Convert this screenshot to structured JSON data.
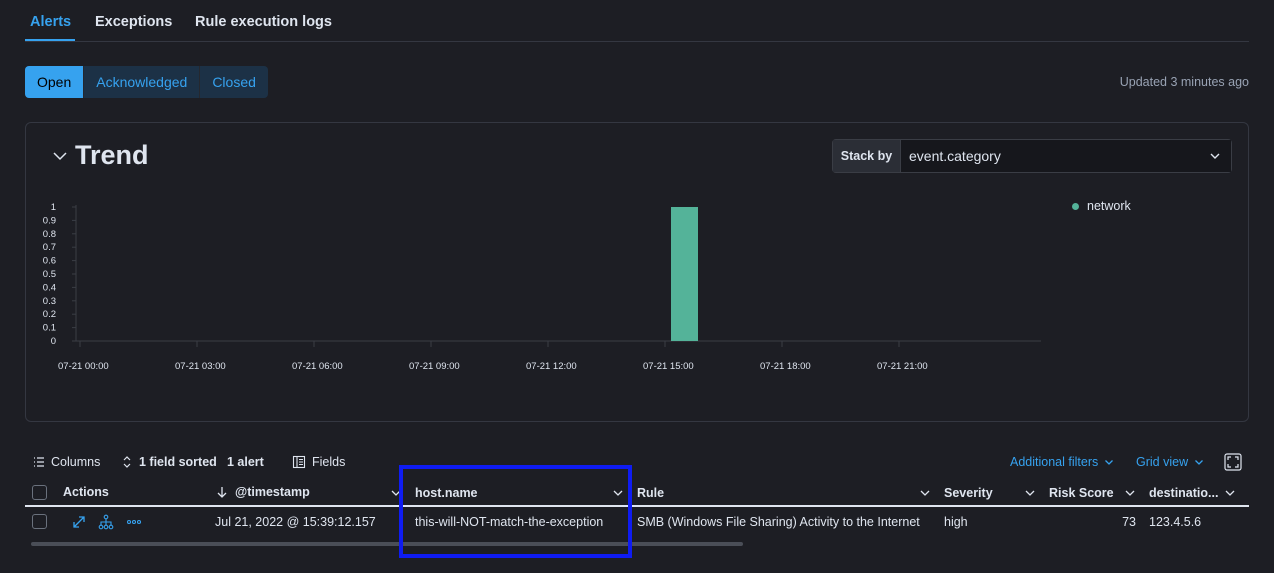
{
  "tabs": [
    {
      "label": "Alerts",
      "active": true
    },
    {
      "label": "Exceptions",
      "active": false
    },
    {
      "label": "Rule execution logs",
      "active": false
    }
  ],
  "status_filter": {
    "options": [
      "Open",
      "Acknowledged",
      "Closed"
    ],
    "selected": "Open"
  },
  "updated_text": "Updated 3 minutes ago",
  "trend": {
    "title": "Trend",
    "stack_by_label": "Stack by",
    "stack_by_value": "event.category"
  },
  "chart_data": {
    "type": "bar",
    "title": "",
    "xlabel": "",
    "ylabel": "",
    "x_ticks": [
      "07-21 00:00",
      "07-21 03:00",
      "07-21 06:00",
      "07-21 09:00",
      "07-21 12:00",
      "07-21 15:00",
      "07-21 18:00",
      "07-21 21:00"
    ],
    "y_ticks": [
      "0",
      "0.1",
      "0.2",
      "0.3",
      "0.4",
      "0.5",
      "0.6",
      "0.7",
      "0.8",
      "0.9",
      "1"
    ],
    "ylim": [
      0,
      1
    ],
    "series": [
      {
        "name": "network",
        "color": "#54b399",
        "points": [
          {
            "x": "07-21 15:30",
            "y": 1
          }
        ]
      }
    ],
    "legend_position": "right",
    "grid": false
  },
  "table": {
    "toolbar": {
      "columns_label": "Columns",
      "sorted_label": "1 field sorted",
      "count_label": "1 alert",
      "fields_label": "Fields",
      "additional_filters_label": "Additional filters",
      "grid_view_label": "Grid view"
    },
    "headers": {
      "actions": "Actions",
      "timestamp": "@timestamp",
      "host": "host.name",
      "rule": "Rule",
      "severity": "Severity",
      "risk": "Risk Score",
      "destination": "destinatio..."
    },
    "rows": [
      {
        "timestamp": "Jul 21, 2022 @ 15:39:12.157",
        "host": "this-will-NOT-match-the-exception",
        "rule": "SMB (Windows File Sharing) Activity to the Internet",
        "severity": "high",
        "risk": "73",
        "destination": "123.4.5.6"
      }
    ]
  }
}
